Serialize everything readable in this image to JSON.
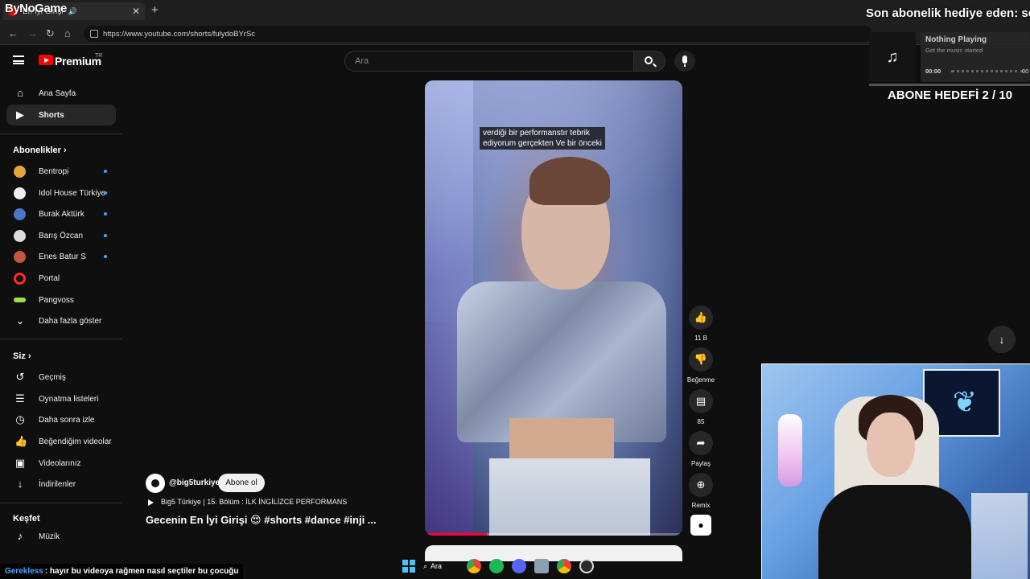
{
  "browser": {
    "tab_title": "En İyi Girişi",
    "url": "https://www.youtube.com/shorts/fulydoBYrSc",
    "overlay_logo": "ByNoGame"
  },
  "header": {
    "brand": "Premium",
    "country": "TR",
    "search_placeholder": "Ara"
  },
  "sidebar": {
    "main": [
      {
        "label": "Ana Sayfa",
        "icon": "home-icon"
      },
      {
        "label": "Shorts",
        "icon": "shorts-icon"
      }
    ],
    "subscriptions_title": "Abonelikler",
    "subscriptions": [
      {
        "label": "Bentropi",
        "color": "#e8a33a"
      },
      {
        "label": "Idol House Türkiye",
        "color": "#f0f0f0"
      },
      {
        "label": "Burak Aktürk",
        "color": "#4a78c8"
      },
      {
        "label": "Barış Özcan",
        "color": "#dcdcdc"
      },
      {
        "label": "Enes Batur S",
        "color": "#c0573e"
      },
      {
        "label": "Portal",
        "color": "#ff2a2a"
      },
      {
        "label": "Pangvoss",
        "color": "#9be14a"
      }
    ],
    "show_more": "Daha fazla göster",
    "you_title": "Siz",
    "you": [
      {
        "label": "Geçmiş",
        "icon": "history-icon"
      },
      {
        "label": "Oynatma listeleri",
        "icon": "playlist-icon"
      },
      {
        "label": "Daha sonra izle",
        "icon": "clock-icon"
      },
      {
        "label": "Beğendiğim videolar",
        "icon": "thumbs-up-icon"
      },
      {
        "label": "Videolarınız",
        "icon": "video-icon"
      },
      {
        "label": "İndirilenler",
        "icon": "download-icon"
      }
    ],
    "explore_title": "Keşfet",
    "explore": [
      {
        "label": "Müzik",
        "icon": "music-icon"
      }
    ]
  },
  "short": {
    "subtitle_line1": "verdiği bir performanstır tebrik",
    "subtitle_line2": "ediyorum gerçekten Ve bir önceki",
    "progress": 0.24,
    "channel": "@big5turkiye",
    "subscribe_label": "Abone ol",
    "music": "Big5 Türkiye | 15. Bölüm : İLK İNGİLİZCE PERFORMANS",
    "title": "Gecenin En İyi Girişi 😍 #shorts #dance #inji ..."
  },
  "actions": {
    "likes": "11 B",
    "dislike": "Beğenme",
    "comments": "85",
    "share": "Paylaş",
    "remix": "Remix"
  },
  "stream": {
    "ticker": "Son abonelik hediye eden: serr",
    "now_playing_title": "Nothing Playing",
    "now_playing_sub": "Get the music started",
    "time_start": "00:00",
    "time_end": "00",
    "goal": "ABONE HEDEFİ 2 / 10",
    "chat_user": "Gerekless",
    "chat_message": ": hayır bu videoya rağmen nasıl seçtiler bu çocuğu"
  },
  "taskbar": {
    "search_label": "Ara",
    "apps": [
      "chrome-icon",
      "spotify-icon",
      "discord-icon",
      "app-icon",
      "chrome-icon",
      "obs-icon"
    ]
  },
  "colors": {
    "background": "#0f0f0f",
    "yt_red": "#ff0000",
    "link_blue": "#3ea6ff",
    "chat_user": "#4fa3ff"
  }
}
